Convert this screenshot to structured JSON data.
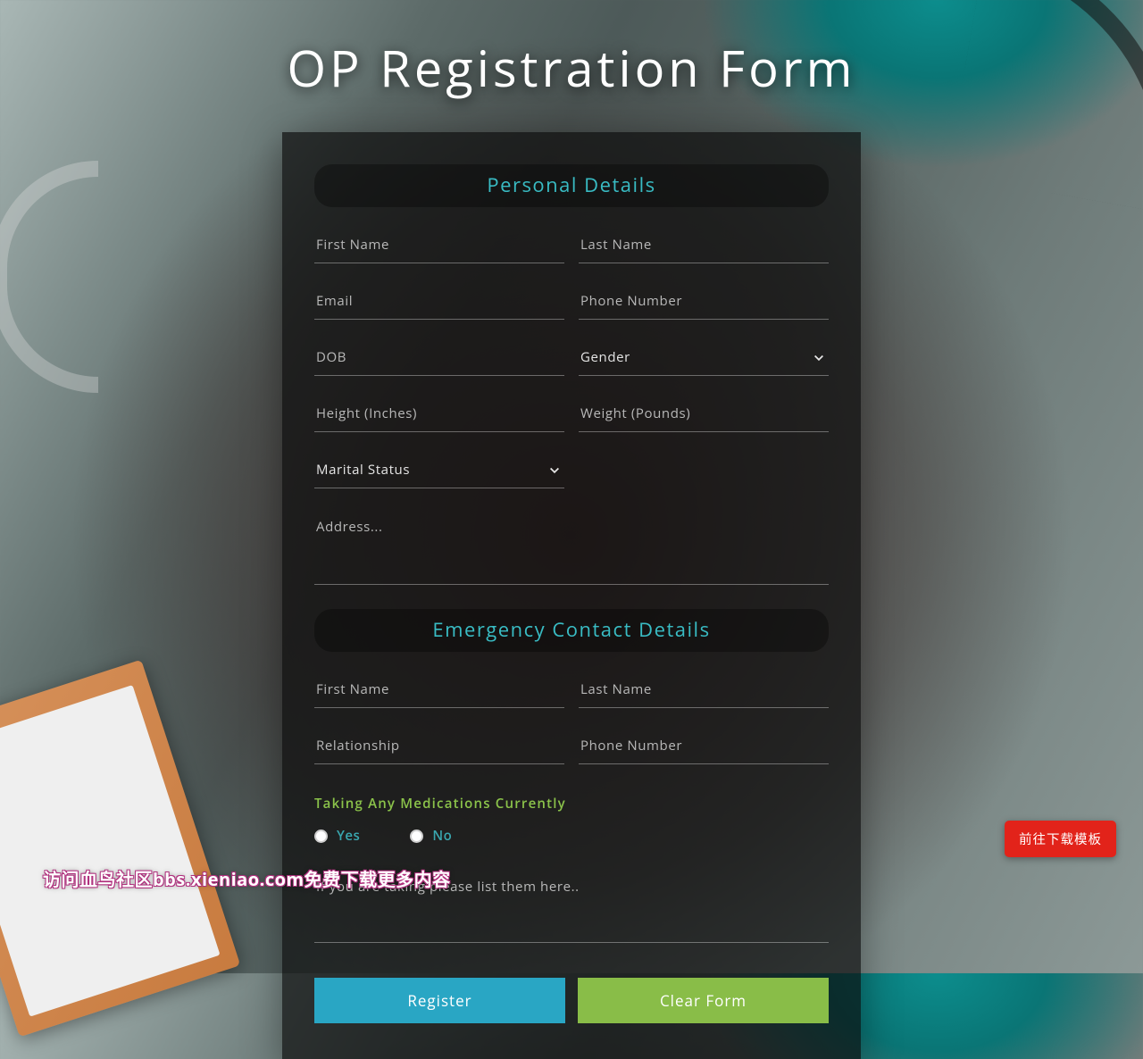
{
  "page": {
    "title": "OP Registration Form"
  },
  "sections": {
    "personal": "Personal Details",
    "emergency": "Emergency Contact Details"
  },
  "personal": {
    "first_name_ph": "First Name",
    "last_name_ph": "Last Name",
    "email_ph": "Email",
    "phone_ph": "Phone Number",
    "dob_ph": "DOB",
    "gender_label": "Gender",
    "height_ph": "Height (Inches)",
    "weight_ph": "Weight (Pounds)",
    "marital_label": "Marital Status",
    "address_ph": "Address..."
  },
  "emergency": {
    "first_name_ph": "First Name",
    "last_name_ph": "Last Name",
    "relationship_ph": "Relationship",
    "phone_ph": "Phone Number"
  },
  "meds": {
    "question": "Taking Any Medications Currently",
    "yes": "Yes",
    "no": "No",
    "list_ph": "If you are taking please list them here.."
  },
  "buttons": {
    "register": "Register",
    "clear": "Clear Form"
  },
  "overlay": {
    "watermark": "访问血鸟社区bbs.xieniao.com免费下载更多内容",
    "download_badge": "前往下载模板"
  }
}
